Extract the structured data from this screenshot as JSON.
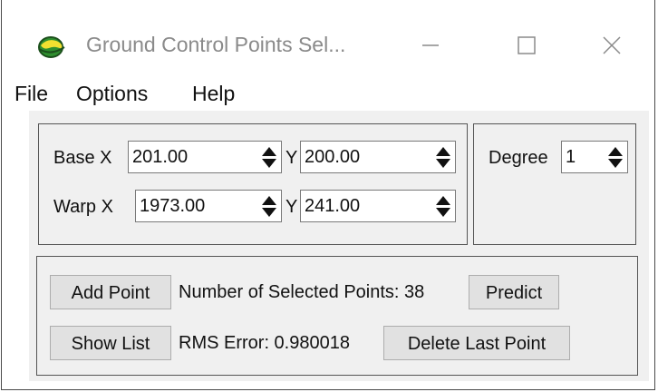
{
  "window": {
    "title": "Ground Control Points Sel...",
    "icon": "app-globe-icon",
    "controls": [
      "minimize-icon",
      "maximize-icon",
      "close-icon"
    ]
  },
  "menu": {
    "file": "File",
    "options": "Options",
    "help": "Help"
  },
  "coords": {
    "base_x_label": "Base X",
    "base_x_value": "201.00",
    "base_y_label": "Y",
    "base_y_value": "200.00",
    "warp_x_label": "Warp X",
    "warp_x_value": "1973.00",
    "warp_y_label": "Y",
    "warp_y_value": "241.00"
  },
  "degree": {
    "label": "Degree",
    "value": "1"
  },
  "actions": {
    "add_point": "Add Point",
    "selected_points_text": "Number of Selected Points: 38",
    "predict": "Predict",
    "show_list": "Show List",
    "rms_text": "RMS Error: 0.980018",
    "delete_last_point": "Delete Last Point"
  },
  "colors": {
    "client_bg": "#f0f0f0",
    "button_bg": "#e1e1e1",
    "title_text": "#8a8a8a"
  }
}
